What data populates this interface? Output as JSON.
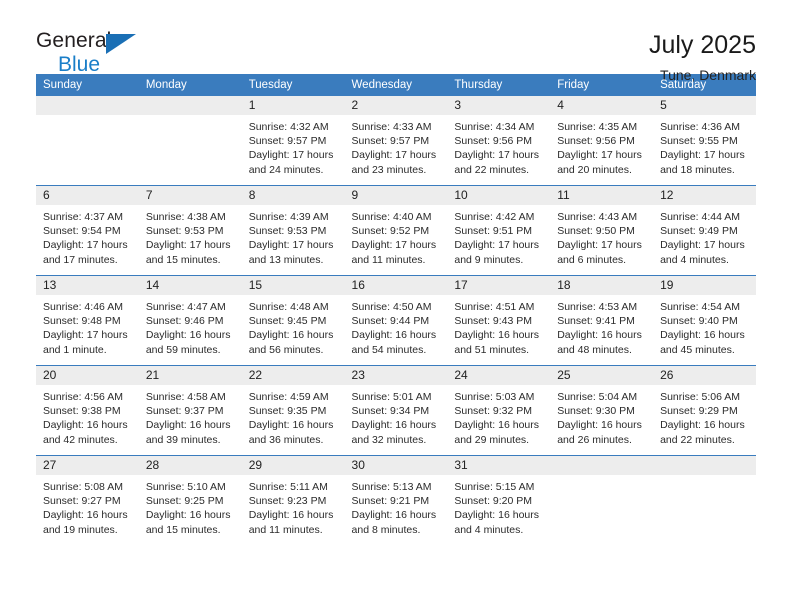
{
  "brand": {
    "name_top": "General",
    "name_bottom": "Blue",
    "triangle_color": "#1a6fb5",
    "blue_color": "#1a7ec8"
  },
  "header": {
    "title": "July 2025",
    "subtitle": "Tune, Denmark"
  },
  "theme": {
    "header_row_bg": "#3a7cbe",
    "daynum_bg": "#ededed",
    "separator": "#3a7cbe"
  },
  "weekday_headers": [
    "Sunday",
    "Monday",
    "Tuesday",
    "Wednesday",
    "Thursday",
    "Friday",
    "Saturday"
  ],
  "weeks": [
    [
      {
        "day": "",
        "sunrise": "",
        "sunset": "",
        "daylight_1": "",
        "daylight_2": ""
      },
      {
        "day": "",
        "sunrise": "",
        "sunset": "",
        "daylight_1": "",
        "daylight_2": ""
      },
      {
        "day": "1",
        "sunrise": "Sunrise: 4:32 AM",
        "sunset": "Sunset: 9:57 PM",
        "daylight_1": "Daylight: 17 hours",
        "daylight_2": "and 24 minutes."
      },
      {
        "day": "2",
        "sunrise": "Sunrise: 4:33 AM",
        "sunset": "Sunset: 9:57 PM",
        "daylight_1": "Daylight: 17 hours",
        "daylight_2": "and 23 minutes."
      },
      {
        "day": "3",
        "sunrise": "Sunrise: 4:34 AM",
        "sunset": "Sunset: 9:56 PM",
        "daylight_1": "Daylight: 17 hours",
        "daylight_2": "and 22 minutes."
      },
      {
        "day": "4",
        "sunrise": "Sunrise: 4:35 AM",
        "sunset": "Sunset: 9:56 PM",
        "daylight_1": "Daylight: 17 hours",
        "daylight_2": "and 20 minutes."
      },
      {
        "day": "5",
        "sunrise": "Sunrise: 4:36 AM",
        "sunset": "Sunset: 9:55 PM",
        "daylight_1": "Daylight: 17 hours",
        "daylight_2": "and 18 minutes."
      }
    ],
    [
      {
        "day": "6",
        "sunrise": "Sunrise: 4:37 AM",
        "sunset": "Sunset: 9:54 PM",
        "daylight_1": "Daylight: 17 hours",
        "daylight_2": "and 17 minutes."
      },
      {
        "day": "7",
        "sunrise": "Sunrise: 4:38 AM",
        "sunset": "Sunset: 9:53 PM",
        "daylight_1": "Daylight: 17 hours",
        "daylight_2": "and 15 minutes."
      },
      {
        "day": "8",
        "sunrise": "Sunrise: 4:39 AM",
        "sunset": "Sunset: 9:53 PM",
        "daylight_1": "Daylight: 17 hours",
        "daylight_2": "and 13 minutes."
      },
      {
        "day": "9",
        "sunrise": "Sunrise: 4:40 AM",
        "sunset": "Sunset: 9:52 PM",
        "daylight_1": "Daylight: 17 hours",
        "daylight_2": "and 11 minutes."
      },
      {
        "day": "10",
        "sunrise": "Sunrise: 4:42 AM",
        "sunset": "Sunset: 9:51 PM",
        "daylight_1": "Daylight: 17 hours",
        "daylight_2": "and 9 minutes."
      },
      {
        "day": "11",
        "sunrise": "Sunrise: 4:43 AM",
        "sunset": "Sunset: 9:50 PM",
        "daylight_1": "Daylight: 17 hours",
        "daylight_2": "and 6 minutes."
      },
      {
        "day": "12",
        "sunrise": "Sunrise: 4:44 AM",
        "sunset": "Sunset: 9:49 PM",
        "daylight_1": "Daylight: 17 hours",
        "daylight_2": "and 4 minutes."
      }
    ],
    [
      {
        "day": "13",
        "sunrise": "Sunrise: 4:46 AM",
        "sunset": "Sunset: 9:48 PM",
        "daylight_1": "Daylight: 17 hours",
        "daylight_2": "and 1 minute."
      },
      {
        "day": "14",
        "sunrise": "Sunrise: 4:47 AM",
        "sunset": "Sunset: 9:46 PM",
        "daylight_1": "Daylight: 16 hours",
        "daylight_2": "and 59 minutes."
      },
      {
        "day": "15",
        "sunrise": "Sunrise: 4:48 AM",
        "sunset": "Sunset: 9:45 PM",
        "daylight_1": "Daylight: 16 hours",
        "daylight_2": "and 56 minutes."
      },
      {
        "day": "16",
        "sunrise": "Sunrise: 4:50 AM",
        "sunset": "Sunset: 9:44 PM",
        "daylight_1": "Daylight: 16 hours",
        "daylight_2": "and 54 minutes."
      },
      {
        "day": "17",
        "sunrise": "Sunrise: 4:51 AM",
        "sunset": "Sunset: 9:43 PM",
        "daylight_1": "Daylight: 16 hours",
        "daylight_2": "and 51 minutes."
      },
      {
        "day": "18",
        "sunrise": "Sunrise: 4:53 AM",
        "sunset": "Sunset: 9:41 PM",
        "daylight_1": "Daylight: 16 hours",
        "daylight_2": "and 48 minutes."
      },
      {
        "day": "19",
        "sunrise": "Sunrise: 4:54 AM",
        "sunset": "Sunset: 9:40 PM",
        "daylight_1": "Daylight: 16 hours",
        "daylight_2": "and 45 minutes."
      }
    ],
    [
      {
        "day": "20",
        "sunrise": "Sunrise: 4:56 AM",
        "sunset": "Sunset: 9:38 PM",
        "daylight_1": "Daylight: 16 hours",
        "daylight_2": "and 42 minutes."
      },
      {
        "day": "21",
        "sunrise": "Sunrise: 4:58 AM",
        "sunset": "Sunset: 9:37 PM",
        "daylight_1": "Daylight: 16 hours",
        "daylight_2": "and 39 minutes."
      },
      {
        "day": "22",
        "sunrise": "Sunrise: 4:59 AM",
        "sunset": "Sunset: 9:35 PM",
        "daylight_1": "Daylight: 16 hours",
        "daylight_2": "and 36 minutes."
      },
      {
        "day": "23",
        "sunrise": "Sunrise: 5:01 AM",
        "sunset": "Sunset: 9:34 PM",
        "daylight_1": "Daylight: 16 hours",
        "daylight_2": "and 32 minutes."
      },
      {
        "day": "24",
        "sunrise": "Sunrise: 5:03 AM",
        "sunset": "Sunset: 9:32 PM",
        "daylight_1": "Daylight: 16 hours",
        "daylight_2": "and 29 minutes."
      },
      {
        "day": "25",
        "sunrise": "Sunrise: 5:04 AM",
        "sunset": "Sunset: 9:30 PM",
        "daylight_1": "Daylight: 16 hours",
        "daylight_2": "and 26 minutes."
      },
      {
        "day": "26",
        "sunrise": "Sunrise: 5:06 AM",
        "sunset": "Sunset: 9:29 PM",
        "daylight_1": "Daylight: 16 hours",
        "daylight_2": "and 22 minutes."
      }
    ],
    [
      {
        "day": "27",
        "sunrise": "Sunrise: 5:08 AM",
        "sunset": "Sunset: 9:27 PM",
        "daylight_1": "Daylight: 16 hours",
        "daylight_2": "and 19 minutes."
      },
      {
        "day": "28",
        "sunrise": "Sunrise: 5:10 AM",
        "sunset": "Sunset: 9:25 PM",
        "daylight_1": "Daylight: 16 hours",
        "daylight_2": "and 15 minutes."
      },
      {
        "day": "29",
        "sunrise": "Sunrise: 5:11 AM",
        "sunset": "Sunset: 9:23 PM",
        "daylight_1": "Daylight: 16 hours",
        "daylight_2": "and 11 minutes."
      },
      {
        "day": "30",
        "sunrise": "Sunrise: 5:13 AM",
        "sunset": "Sunset: 9:21 PM",
        "daylight_1": "Daylight: 16 hours",
        "daylight_2": "and 8 minutes."
      },
      {
        "day": "31",
        "sunrise": "Sunrise: 5:15 AM",
        "sunset": "Sunset: 9:20 PM",
        "daylight_1": "Daylight: 16 hours",
        "daylight_2": "and 4 minutes."
      },
      {
        "day": "",
        "sunrise": "",
        "sunset": "",
        "daylight_1": "",
        "daylight_2": ""
      },
      {
        "day": "",
        "sunrise": "",
        "sunset": "",
        "daylight_1": "",
        "daylight_2": ""
      }
    ]
  ]
}
